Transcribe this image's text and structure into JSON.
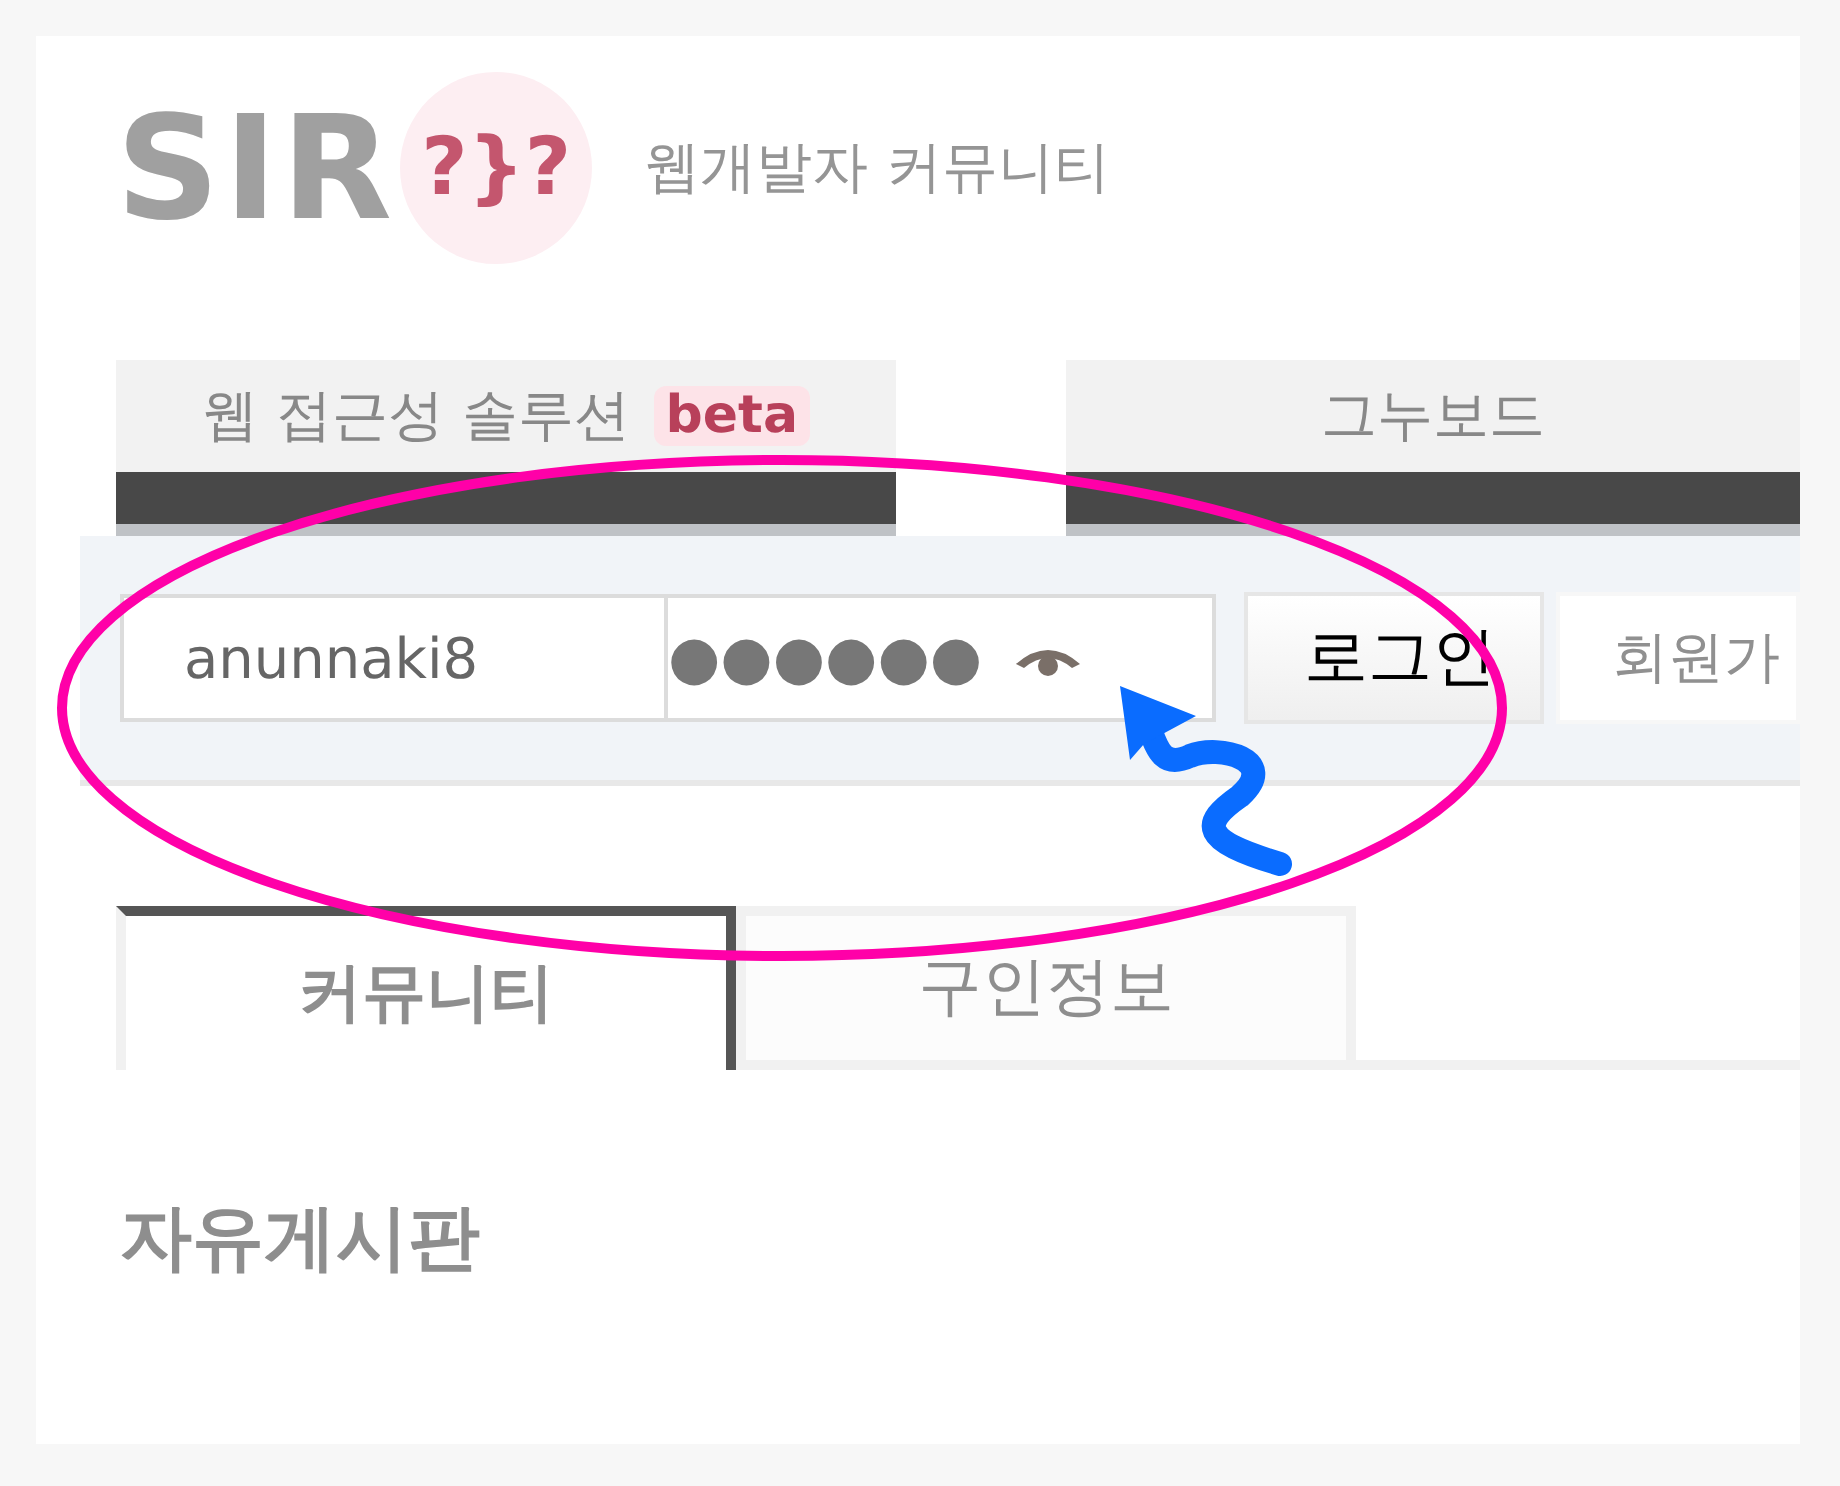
{
  "header": {
    "logo_text": "SIR",
    "logo_mark": "?}?",
    "tagline": "웹개발자 커뮤니티"
  },
  "top_tabs": [
    {
      "label": "웹 접근성 솔루션",
      "badge": "beta"
    },
    {
      "label": "그누보드"
    }
  ],
  "login": {
    "username": "anunnaki8",
    "password": "●●●●●●",
    "login_button": "로그인",
    "signup_button": "회원가"
  },
  "board_tabs": [
    {
      "label": "커뮤니티",
      "selected": true
    },
    {
      "label": "구인정보",
      "selected": false
    }
  ],
  "heading": "자유게시판"
}
